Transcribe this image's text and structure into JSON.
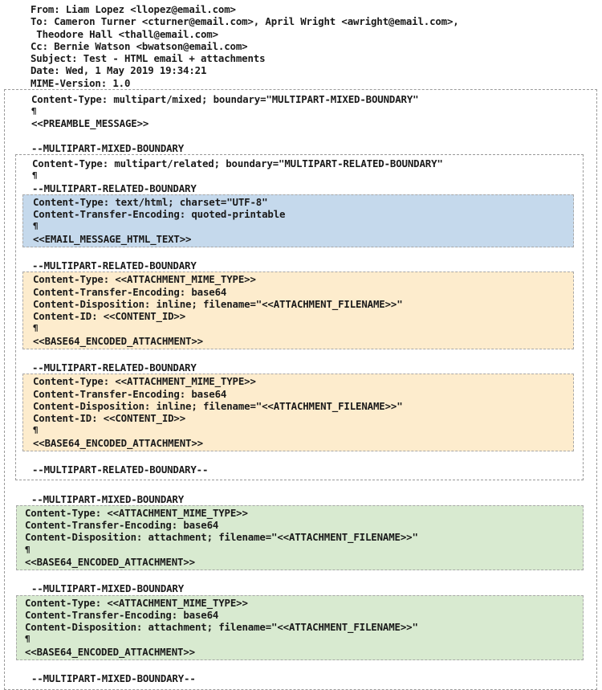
{
  "headers": {
    "lines": [
      "From: Liam Lopez <llopez@email.com>",
      "To: Cameron Turner <cturner@email.com>, April Wright <awright@email.com>,",
      " Theodore Hall <thall@email.com>",
      "Cc: Bernie Watson <bwatson@email.com>",
      "Subject: Test - HTML email + attachments",
      "Date: Wed, 1 May 2019 19:34:21",
      "MIME-Version: 1.0"
    ]
  },
  "mixed": {
    "content_type": "Content-Type: multipart/mixed; boundary=\"MULTIPART-MIXED-BOUNDARY\"",
    "blank": "¶",
    "preamble": "<<PREAMBLE_MESSAGE>>",
    "boundary": "--MULTIPART-MIXED-BOUNDARY",
    "boundary_close": "--MULTIPART-MIXED-BOUNDARY--"
  },
  "related": {
    "content_type": "Content-Type: multipart/related; boundary=\"MULTIPART-RELATED-BOUNDARY\"",
    "blank": "¶",
    "boundary": "--MULTIPART-RELATED-BOUNDARY",
    "boundary_close": "--MULTIPART-RELATED-BOUNDARY--"
  },
  "html_part": {
    "content_type": "Content-Type: text/html; charset=\"UTF-8\"",
    "encoding": "Content-Transfer-Encoding: quoted-printable",
    "blank": "¶",
    "body": "<<EMAIL_MESSAGE_HTML_TEXT>>"
  },
  "inline_part_1": {
    "content_type": "Content-Type: <<ATTACHMENT_MIME_TYPE>>",
    "encoding": "Content-Transfer-Encoding: base64",
    "disposition": "Content-Disposition: inline; filename=\"<<ATTACHMENT_FILENAME>>\"",
    "content_id": "Content-ID: <<CONTENT_ID>>",
    "blank": "¶",
    "body": "<<BASE64_ENCODED_ATTACHMENT>>"
  },
  "inline_part_2": {
    "content_type": "Content-Type: <<ATTACHMENT_MIME_TYPE>>",
    "encoding": "Content-Transfer-Encoding: base64",
    "disposition": "Content-Disposition: inline; filename=\"<<ATTACHMENT_FILENAME>>\"",
    "content_id": "Content-ID: <<CONTENT_ID>>",
    "blank": "¶",
    "body": "<<BASE64_ENCODED_ATTACHMENT>>"
  },
  "attachment_part_1": {
    "content_type": "Content-Type: <<ATTACHMENT_MIME_TYPE>>",
    "encoding": "Content-Transfer-Encoding: base64",
    "disposition": "Content-Disposition: attachment; filename=\"<<ATTACHMENT_FILENAME>>\"",
    "blank": "¶",
    "body": "<<BASE64_ENCODED_ATTACHMENT>>"
  },
  "attachment_part_2": {
    "content_type": "Content-Type: <<ATTACHMENT_MIME_TYPE>>",
    "encoding": "Content-Transfer-Encoding: base64",
    "disposition": "Content-Disposition: attachment; filename=\"<<ATTACHMENT_FILENAME>>\"",
    "blank": "¶",
    "body": "<<BASE64_ENCODED_ATTACHMENT>>"
  },
  "colors": {
    "html_part_bg": "#c5d9ec",
    "inline_part_bg": "#fdeccd",
    "attachment_part_bg": "#d8ead0",
    "border": "#9a9a9a",
    "text": "#1a1a1a",
    "page_bg": "#ffffff"
  }
}
